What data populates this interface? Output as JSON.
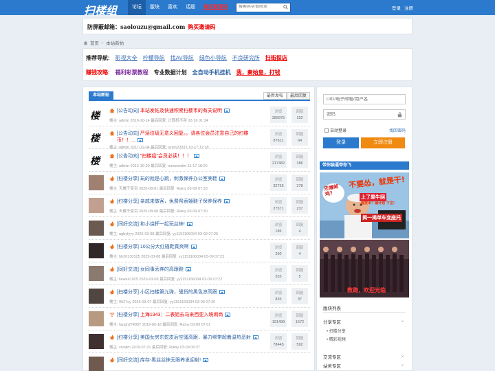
{
  "header": {
    "logo": "扫楼组",
    "nav": [
      "论坛",
      "版块",
      "喜欢",
      "话题",
      "购买邀请码"
    ],
    "search_placeholder": "搜索其实很简单",
    "login": "登录",
    "register": "注册"
  },
  "notice": {
    "label": "防屏蔽邮箱：",
    "email": "saolouzu@gmail.com",
    "buy": "购买邀请码"
  },
  "breadcrumb": {
    "home": "首页",
    "current": "本站新帖"
  },
  "guide": {
    "row1_label": "推荐导航:",
    "row1_links": [
      "影视大全",
      "柠檬导航",
      "找AV导航",
      "绿色小导航",
      "不良研究所",
      "扫街探店"
    ],
    "row2_label": "赚钱攻略:",
    "row2_links": [
      "福利彩票教程",
      "专业数据计划",
      "全自动手机挂机",
      "我，秦始皇，打钱"
    ]
  },
  "main": {
    "tab": "本站新帖",
    "sort": [
      "最新发帖",
      "最后回复"
    ],
    "view_label": "浏览",
    "reply_label": "回复",
    "threads": [
      {
        "cat": "[公告动向]",
        "title": "本站发帖及快速积累扫楼币的有关说明",
        "title2": "",
        "red": true,
        "meta": "楼主: admin 2016-10-14   最后回复: 计算机不用 02-16 01:34",
        "views": "289975",
        "replies": "152",
        "avatar": "sig",
        "icon": "home"
      },
      {
        "cat": "[公告动向]",
        "title": "严惩垃圾无意义回复。。请各位会员注意自己的扫楼",
        "title2": "币！！...",
        "red": true,
        "meta": "楼主: admin 2017-12-04   最后回复: szm123321 10-17 12:39",
        "views": "87611",
        "replies": "64",
        "avatar": "sig",
        "icon": "home"
      },
      {
        "cat": "[公告动向]",
        "title": "\"扫楼组\"会员必读！！！",
        "title2": "",
        "red": true,
        "meta": "楼主: admin 2016-10-20   最后回复: nuwenndm 11-17 18:20",
        "views": "217482",
        "replies": "186",
        "avatar": "sig",
        "icon": "home"
      },
      {
        "cat": "[扫楼分享]",
        "title": "玩的就是心跳，刺激保养办公室美鞋",
        "title2": "",
        "red": false,
        "meta": "楼主: 天楼子变目 2025-08-01   最后回复: Rainy 03-09 07:33",
        "views": "32756",
        "replies": "278",
        "avatar": "p1",
        "icon": "fire"
      },
      {
        "cat": "[扫楼分享]",
        "title": "亲戚来做客，免费帮表嫂鞋子保养保养",
        "title2": "",
        "red": false,
        "meta": "楼主: 天楼子变目 2025-08-08   最后回复: Rainy 03-09 07:30",
        "views": "27571",
        "replies": "237",
        "avatar": "p2",
        "icon": "fire"
      },
      {
        "cat": "[同好交流]",
        "title": "和小烧杯一起玩丝袜!",
        "title2": "",
        "red": false,
        "meta": "楼主: agbyfyyy 2025-03-08   最后回复: yy1151166034 03-09 07:25",
        "views": "186",
        "replies": "4",
        "avatar": "p3",
        "icon": "fire"
      },
      {
        "cat": "[扫楼分享]",
        "title": "10公分大红骚鞋真爽啊",
        "title2": "",
        "red": false,
        "meta": "楼主: hh20130325 2025-03-08   最后回复: yy1151166034 03-09 07:23",
        "views": "260",
        "replies": "4",
        "avatar": "p4",
        "icon": "fire"
      },
      {
        "cat": "[同好交流]",
        "title": "女同事丢弃的高跟鞋",
        "title2": "",
        "red": false,
        "meta": "楼主: liewen1025 2025-03-08   最后回复: yy1151166034 03-09 07:22",
        "views": "355",
        "replies": "5",
        "avatar": "p5",
        "icon": "fire"
      },
      {
        "cat": "[扫楼分享]",
        "title": "小区扫楼第九弹，骚货的黑色凉高跟",
        "title2": "",
        "red": false,
        "meta": "楼主: 9527cy 2025-03-07   最后回复: yy1151166034 03-09 07:20",
        "views": "835",
        "replies": "37",
        "avatar": "p6",
        "icon": "fire"
      },
      {
        "cat": "[扫楼分享]",
        "title": "上海1943：二表姐去马来西亚入境闹商",
        "title2": "",
        "red": true,
        "meta": "楼主: fangh274007 2019-05-18   最后回复: Rainy 03-09 07:01",
        "views": "191499",
        "replies": "1572",
        "avatar": "p7",
        "icon": "wifi"
      },
      {
        "cat": "[扫楼分享]",
        "title": "美国女房东蛇皮后空骚高跟，暴力绑带超着温热恶射",
        "title2": "",
        "red": false,
        "meta": "楼主: vivalim 2019-07-31   最后回复: Rainy 03-09 06:37",
        "views": "78445",
        "replies": "592",
        "avatar": "p8",
        "icon": "fire"
      },
      {
        "cat": "[同好交流]",
        "title": "库存-黑丝丝袜无限养发迎射!",
        "title2": "",
        "red": false,
        "meta": "",
        "views": "",
        "replies": "",
        "avatar": "p9",
        "icon": "fire"
      }
    ]
  },
  "side": {
    "user_placeholder": "UID/电子邮箱/用户名",
    "pass_placeholder": "密码",
    "auto_login": "自动登录",
    "forgot": "找回密码",
    "login_btn": "登录",
    "register_btn": "立即注册",
    "ad_head": "带你装逼带你飞",
    "ad1_line1": "不要怂，就是干!",
    "ad1_line2": "上了犀牛网",
    "ad1_line3": "看技术！漏计划 下注！",
    "ad1_line4": "揭一揭单车变座托",
    "ad1_side": "还嫌邮鸡?",
    "ad2_text": "教跪，欢迎光临",
    "board_title": "版块列表",
    "boards": [
      {
        "name": "分享专区",
        "subs": [
          "扫楼分享",
          "精彩视频"
        ]
      },
      {
        "name": "交流专区",
        "subs": []
      },
      {
        "name": "站务专区",
        "subs": []
      }
    ]
  }
}
